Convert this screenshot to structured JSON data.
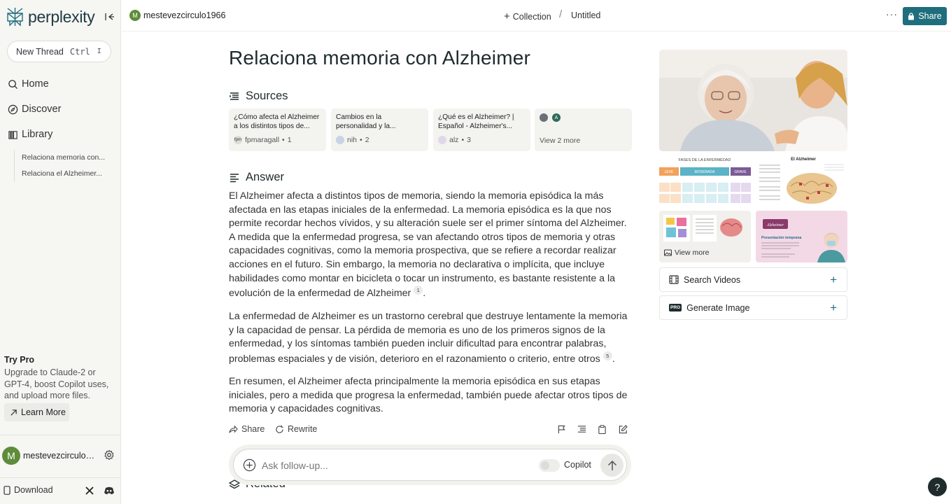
{
  "app": {
    "name": "perplexity"
  },
  "sidebar": {
    "new_thread": {
      "label": "New Thread",
      "shortcut_key1": "Ctrl",
      "shortcut_key2": "I"
    },
    "nav": [
      {
        "label": "Home",
        "icon": "search-icon"
      },
      {
        "label": "Discover",
        "icon": "compass-icon"
      },
      {
        "label": "Library",
        "icon": "library-icon"
      }
    ],
    "library_items": [
      "Relaciona memoria con...",
      "Relaciona el Alzheimer..."
    ],
    "try_pro": {
      "title": "Try Pro",
      "description": "Upgrade to Claude-2 or GPT-4, boost Copilot uses, and upload more files.",
      "button": "Learn More"
    },
    "user": {
      "initial": "M",
      "name": "mestevezcirculo1966"
    },
    "download": "Download"
  },
  "header": {
    "user": {
      "initial": "M",
      "name": "mestevezcirculo1966"
    },
    "collection": "Collection",
    "separator": "/",
    "thread_title": "Untitled",
    "share": "Share"
  },
  "main": {
    "title": "Relaciona memoria con Alzheimer",
    "sources_heading": "Sources",
    "sources": [
      {
        "title": "¿Cómo afecta el Alzheimer a los distintos tipos de...",
        "site": "fpmaragall",
        "num": "1"
      },
      {
        "title": "Cambios en la personalidad y la...",
        "site": "nih",
        "num": "2"
      },
      {
        "title": "¿Qué es el Alzheimer? | Español - Alzheimer's...",
        "site": "alz",
        "num": "3"
      }
    ],
    "sources_more": "View 2 more",
    "answer_heading": "Answer",
    "answer_paragraphs": [
      {
        "text": "El Alzheimer afecta a distintos tipos de memoria, siendo la memoria episódica la más afectada en las etapas iniciales de la enfermedad. La memoria episódica es la que nos permite recordar hechos vívidos, y su alteración suele ser el primer síntoma del Alzheimer. A medida que la enfermedad progresa, se van afectando otros tipos de memoria y otras capacidades cognitivas, como la memoria prospectiva, que se refiere a recordar realizar acciones en el futuro. Sin embargo, la memoria no declarativa o implícita, que incluye habilidades como montar en bicicleta o tocar un instrumento, es bastante resistente a la evolución de la enfermedad de Alzheimer",
        "cite": "1"
      },
      {
        "text": "La enfermedad de Alzheimer es un trastorno cerebral que destruye lentamente la memoria y la capacidad de pensar. La pérdida de memoria es uno de los primeros signos de la enfermedad, y los síntomas también pueden incluir dificultad para encontrar palabras, problemas espaciales y de visión, deterioro en el razonamiento o criterio, entre otros",
        "cite": "5"
      },
      {
        "text": "En resumen, el Alzheimer afecta principalmente la memoria episódica en sus etapas iniciales, pero a medida que progresa la enfermedad, también puede afectar otros tipos de memoria y capacidades cognitivas.",
        "cite": ""
      }
    ],
    "actions": {
      "share": "Share",
      "rewrite": "Rewrite"
    },
    "related_heading": "Related",
    "followup": {
      "placeholder": "Ask follow-up...",
      "copilot": "Copilot"
    }
  },
  "right_panel": {
    "tiles": [
      {
        "header": "FASES DE LA ENFERMEDAD",
        "labels": [
          "LEVE",
          "MODERADA",
          "GRAVE"
        ]
      },
      {
        "header": "El Alzheimer"
      },
      {},
      {
        "header": "Alzheimer",
        "subheader": "Presentación temprana"
      }
    ],
    "view_more": "View more",
    "search_videos": "Search Videos",
    "generate_image": "Generate Image",
    "generate_badge": "PRO"
  },
  "help": "?"
}
